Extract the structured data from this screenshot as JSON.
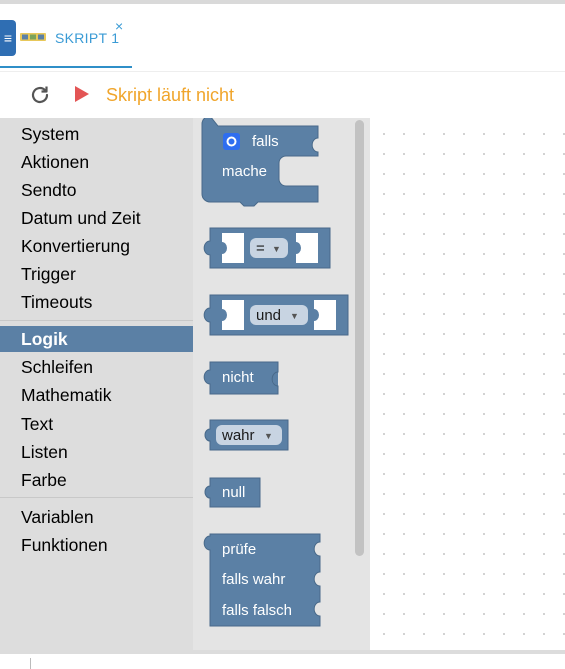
{
  "tab": {
    "label": "SKRIPT 1",
    "close": "×"
  },
  "menu": {
    "icon": "≡"
  },
  "toolbar": {
    "status": "Skript läuft nicht"
  },
  "toolbox": {
    "group1": [
      "System",
      "Aktionen",
      "Sendto",
      "Datum und Zeit",
      "Konvertierung",
      "Trigger",
      "Timeouts"
    ],
    "group2": [
      "Logik",
      "Schleifen",
      "Mathematik",
      "Text",
      "Listen",
      "Farbe"
    ],
    "group3": [
      "Variablen",
      "Funktionen"
    ],
    "selected": "Logik"
  },
  "blocks": {
    "if_label": "falls",
    "do_label": "mache",
    "compare_op": "=",
    "logic_op": "und",
    "not_label": "nicht",
    "bool_value": "wahr",
    "null_label": "null",
    "ternary_test": "prüfe",
    "ternary_true": "falls wahr",
    "ternary_false": "falls falsch"
  },
  "colors": {
    "block": "#5b80a5",
    "accent": "#f0a52b",
    "tab": "#3a9bd5",
    "play": "#e35555"
  }
}
